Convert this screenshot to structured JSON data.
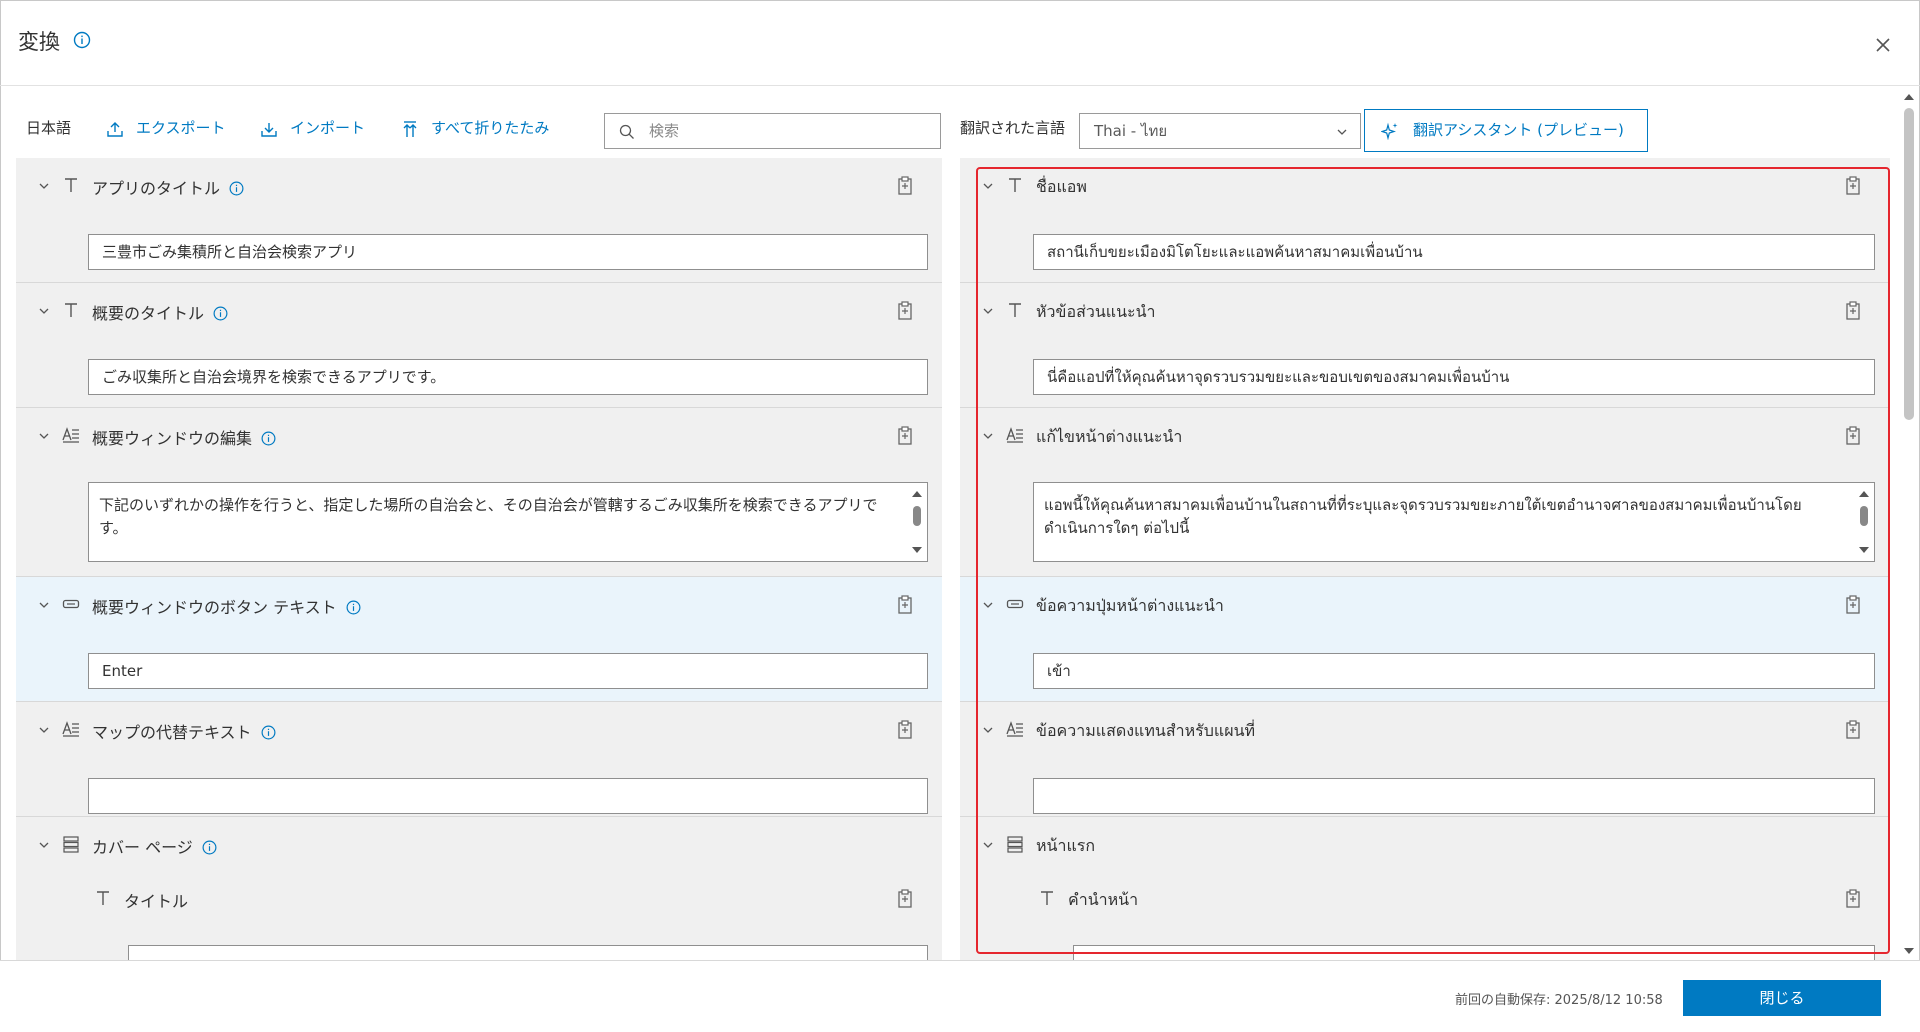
{
  "header": {
    "title": "変換",
    "info_icon": "info-icon",
    "close_icon": "close-icon"
  },
  "toolbar": {
    "source_language": "日本語",
    "export_label": "エクスポート",
    "import_label": "インポート",
    "collapse_all_label": "すべて折りたたみ",
    "search_placeholder": "検索",
    "translated_language_label": "翻訳された言語",
    "target_language": "Thai - ไทย",
    "assistant_label": "翻訳アシスタント (プレビュー)"
  },
  "left_rows": [
    {
      "label": "アプリのタイトル",
      "type_icon": "text-icon",
      "value": "三豊市ごみ集積所と自治会検索アプリ"
    },
    {
      "label": "概要のタイトル",
      "type_icon": "text-icon",
      "value": "ごみ収集所と自治会境界を検索できるアプリです。"
    },
    {
      "label": "概要ウィンドウの編集",
      "type_icon": "rich-text-icon",
      "value": "下記のいずれかの操作を行うと、指定した場所の自治会と、その自治会が管轄するごみ収集所を検索できるアプリです。"
    },
    {
      "label": "概要ウィンドウのボタン テキスト",
      "type_icon": "button-icon",
      "value": "Enter"
    },
    {
      "label": "マップの代替テキスト",
      "type_icon": "rich-text-icon",
      "value": ""
    },
    {
      "label": "カバー ページ",
      "type_icon": "stack-icon",
      "sub_label": "タイトル",
      "sub_type_icon": "text-icon"
    }
  ],
  "right_rows": [
    {
      "label": "ชื่อแอพ",
      "value": "สถานีเก็บขยะเมืองมิโตโยะและแอพค้นหาสมาคมเพื่อนบ้าน"
    },
    {
      "label": "หัวข้อส่วนแนะนำ",
      "value": "นี่คือแอปที่ให้คุณค้นหาจุดรวบรวมขยะและขอบเขตของสมาคมเพื่อนบ้าน"
    },
    {
      "label": "แก้ไขหน้าต่างแนะนำ",
      "value": "แอพนี้ให้คุณค้นหาสมาคมเพื่อนบ้านในสถานที่ที่ระบุและจุดรวบรวมขยะภายใต้เขตอำนาจศาลของสมาคมเพื่อนบ้านโดยดำเนินการใดๆ ต่อไปนี้"
    },
    {
      "label": "ข้อความปุ่มหน้าต่างแนะนำ",
      "value": "เข้า"
    },
    {
      "label": "ข้อความแสดงแทนสำหรับแผนที่",
      "value": ""
    },
    {
      "label": "หน้าแรก",
      "sub_label": "คำนำหน้า"
    }
  ],
  "footer": {
    "autosave": "前回の自動保存: 2025/8/12 10:58",
    "close_label": "閉じる"
  },
  "colors": {
    "accent": "#007ac2",
    "highlight_border": "#e5262e",
    "panel_bg": "#f0f0f0"
  }
}
